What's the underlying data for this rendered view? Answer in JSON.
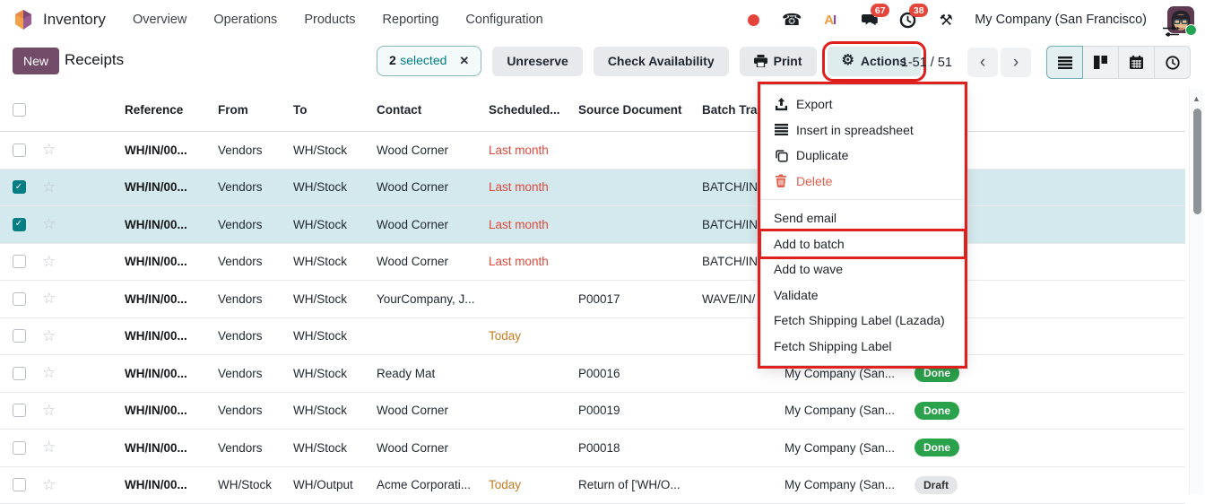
{
  "navbar": {
    "app_name": "Inventory",
    "menus": [
      "Overview",
      "Operations",
      "Products",
      "Reporting",
      "Configuration"
    ],
    "icons": [
      "record-dot",
      "phone",
      "ai",
      "messages",
      "activities",
      "tools"
    ],
    "message_count": "67",
    "activity_count": "38",
    "company": "My Company (San Francisco)"
  },
  "control": {
    "new_label": "New",
    "title": "Receipts",
    "selection": {
      "count": "2",
      "label": "selected",
      "close": "✕"
    },
    "buttons": {
      "unreserve": "Unreserve",
      "check": "Check Availability",
      "print": "Print",
      "actions": "Actions"
    },
    "pagination": "1-51 / 51",
    "view_switcher": [
      "list",
      "kanban",
      "calendar",
      "activity"
    ],
    "active_view": "list"
  },
  "table": {
    "headers": [
      "Reference",
      "From",
      "To",
      "Contact",
      "Scheduled...",
      "Source Document",
      "Batch Tra"
    ],
    "rows": [
      {
        "checked": false,
        "selected": false,
        "reference": "WH/IN/00...",
        "from": "Vendors",
        "to": "WH/Stock",
        "contact": "Wood Corner",
        "scheduled": "Last month",
        "scheduled_tone": "danger",
        "source": "",
        "batch": "",
        "company": "",
        "status": ""
      },
      {
        "checked": true,
        "selected": true,
        "reference": "WH/IN/00...",
        "from": "Vendors",
        "to": "WH/Stock",
        "contact": "Wood Corner",
        "scheduled": "Last month",
        "scheduled_tone": "danger",
        "source": "",
        "batch": "BATCH/IN",
        "company": "",
        "status": ""
      },
      {
        "checked": true,
        "selected": true,
        "reference": "WH/IN/00...",
        "from": "Vendors",
        "to": "WH/Stock",
        "contact": "Wood Corner",
        "scheduled": "Last month",
        "scheduled_tone": "danger",
        "source": "",
        "batch": "BATCH/IN",
        "company": "",
        "status": ""
      },
      {
        "checked": false,
        "selected": false,
        "reference": "WH/IN/00...",
        "from": "Vendors",
        "to": "WH/Stock",
        "contact": "Wood Corner",
        "scheduled": "Last month",
        "scheduled_tone": "danger",
        "source": "",
        "batch": "BATCH/IN",
        "company": "",
        "status": ""
      },
      {
        "checked": false,
        "selected": false,
        "reference": "WH/IN/00...",
        "from": "Vendors",
        "to": "WH/Stock",
        "contact": "YourCompany, J...",
        "scheduled": "",
        "scheduled_tone": "",
        "source": "P00017",
        "batch": "WAVE/IN/",
        "company": "",
        "status": ""
      },
      {
        "checked": false,
        "selected": false,
        "reference": "WH/IN/00...",
        "from": "Vendors",
        "to": "WH/Stock",
        "contact": "",
        "scheduled": "Today",
        "scheduled_tone": "warning",
        "source": "",
        "batch": "",
        "company": "",
        "status": ""
      },
      {
        "checked": false,
        "selected": false,
        "reference": "WH/IN/00...",
        "from": "Vendors",
        "to": "WH/Stock",
        "contact": "Ready Mat",
        "scheduled": "",
        "scheduled_tone": "",
        "source": "P00016",
        "batch": "",
        "company": "My Company (San...",
        "status": "Done"
      },
      {
        "checked": false,
        "selected": false,
        "reference": "WH/IN/00...",
        "from": "Vendors",
        "to": "WH/Stock",
        "contact": "Wood Corner",
        "scheduled": "",
        "scheduled_tone": "",
        "source": "P00019",
        "batch": "",
        "company": "My Company (San...",
        "status": "Done"
      },
      {
        "checked": false,
        "selected": false,
        "reference": "WH/IN/00...",
        "from": "Vendors",
        "to": "WH/Stock",
        "contact": "Wood Corner",
        "scheduled": "",
        "scheduled_tone": "",
        "source": "P00018",
        "batch": "",
        "company": "My Company (San...",
        "status": "Done"
      },
      {
        "checked": false,
        "selected": false,
        "reference": "WH/IN/00...",
        "from": "WH/Stock",
        "to": "WH/Output",
        "contact": "Acme Corporati...",
        "scheduled": "Today",
        "scheduled_tone": "warning",
        "source": "Return of ['WH/O...",
        "batch": "",
        "company": "My Company (San...",
        "status": "Draft"
      }
    ]
  },
  "dropdown": {
    "items": [
      {
        "label": "Export",
        "icon": "export"
      },
      {
        "label": "Insert in spreadsheet",
        "icon": "list"
      },
      {
        "label": "Duplicate",
        "icon": "copy"
      },
      {
        "label": "Delete",
        "icon": "trash",
        "danger": true,
        "separator_after": true
      },
      {
        "label": "Send email"
      },
      {
        "label": "Add to batch",
        "highlight": true
      },
      {
        "label": "Add to wave"
      },
      {
        "label": "Validate"
      },
      {
        "label": "Fetch Shipping Label (Lazada)"
      },
      {
        "label": "Fetch Shipping Label"
      }
    ]
  },
  "colors": {
    "brand_purple": "#714B67",
    "accent_teal": "#017e84",
    "selected_row": "#d4e9ed",
    "danger_text": "#de483c",
    "warning_text": "#c57c1f",
    "done_badge": "#2aa14b",
    "draft_badge": "#e3e5e9",
    "annotation_red": "#e0201d",
    "counter_badge": "#e5453a"
  }
}
